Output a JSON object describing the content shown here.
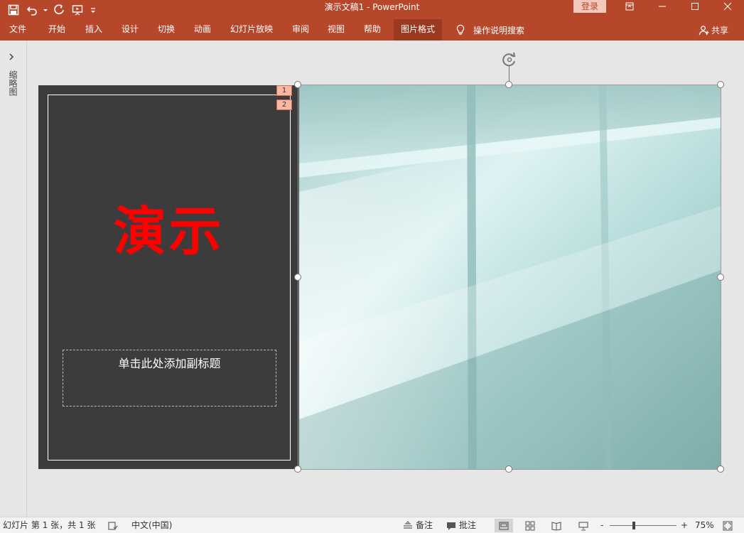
{
  "window": {
    "title": "演示文稿1  -  PowerPoint",
    "login": "登录"
  },
  "quick_access": {
    "icons": [
      "save-icon",
      "undo-icon",
      "redo-icon",
      "start-slideshow-icon",
      "customize-qat-icon"
    ]
  },
  "ribbon": {
    "tabs": [
      {
        "label": "文件"
      },
      {
        "label": "开始"
      },
      {
        "label": "插入"
      },
      {
        "label": "设计"
      },
      {
        "label": "切换"
      },
      {
        "label": "动画"
      },
      {
        "label": "幻灯片放映"
      },
      {
        "label": "审阅"
      },
      {
        "label": "视图"
      },
      {
        "label": "帮助"
      },
      {
        "label": "图片格式",
        "active": true
      }
    ],
    "tell_me": "操作说明搜索",
    "share": "共享"
  },
  "thumbnail_pane": {
    "label": "缩略图"
  },
  "slide": {
    "title": "演示",
    "subtitle_placeholder": "单击此处添加副标题",
    "animation_badges": [
      "1",
      "2"
    ],
    "colors": {
      "panel": "#3c3c3c",
      "title": "#ff0000",
      "frame": "#ffffff"
    }
  },
  "status": {
    "slide_info": "幻灯片 第 1 张，共 1 张",
    "language": "中文(中国)",
    "notes": "备注",
    "comments": "批注",
    "zoom_minus": "-",
    "zoom_plus": "+",
    "zoom": "75%",
    "zoom_value": 75
  },
  "theme": {
    "accent": "#b7472a",
    "accent_dark": "#9a3a21"
  }
}
